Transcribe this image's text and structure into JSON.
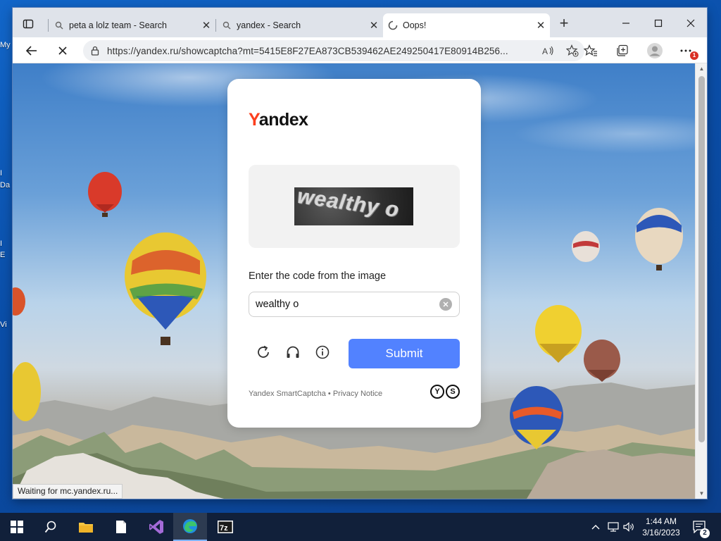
{
  "desktop": {
    "fragments": [
      "My",
      "I",
      "Da",
      "I",
      "E",
      "Vi"
    ]
  },
  "browser": {
    "tabs": [
      {
        "title": "peta a lolz team - Search",
        "icon": "search-icon",
        "active": false
      },
      {
        "title": "yandex - Search",
        "icon": "search-icon",
        "active": false
      },
      {
        "title": "Oops!",
        "icon": "loading-spinner-icon",
        "active": true
      }
    ],
    "address": {
      "url": "https://yandex.ru/showcaptcha?mt=5415E8F27EA873CB539462AE249250417E80914B256..."
    },
    "notification_badge": "1",
    "status_text": "Waiting for mc.yandex.ru..."
  },
  "captcha": {
    "brand": {
      "first_letter": "Y",
      "rest": "andex"
    },
    "image_text": "wealthy o",
    "prompt": "Enter the code from the image",
    "answer_value": "wealthy o",
    "submit_label": "Submit",
    "footer": {
      "smartcaptcha": "Yandex SmartCaptcha",
      "separator": " • ",
      "privacy": "Privacy Notice"
    },
    "smart_logo": [
      "Y",
      "S"
    ],
    "colors": {
      "accent": "#5282ff",
      "brand_red": "#fc3f1d"
    }
  },
  "taskbar": {
    "time": "1:44 AM",
    "date": "3/16/2023",
    "notification_count": "2",
    "apps": [
      "start-button",
      "search-button",
      "file-explorer",
      "notepad",
      "visual-studio",
      "edge",
      "7zip"
    ]
  }
}
